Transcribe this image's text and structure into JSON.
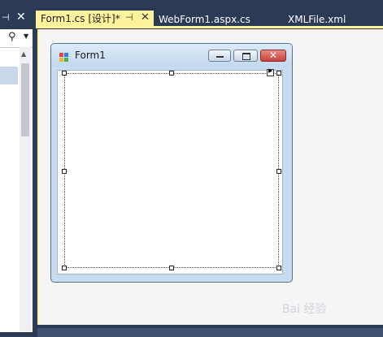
{
  "tabs": [
    {
      "label": "Form1.cs [设计]*",
      "active": true
    },
    {
      "label": "WebForm1.aspx.cs",
      "active": false
    },
    {
      "label": "XMLFile.xml",
      "active": false
    }
  ],
  "icons": {
    "pin": "pin-icon",
    "close": "close-icon",
    "search": "search-icon",
    "dropdown": "chevron-down-icon",
    "scroll_up": "chevron-up-icon",
    "form": "form-icon",
    "minimize": "minimize-icon",
    "maximize": "maximize-icon",
    "smart_tag": "smart-tag-icon"
  },
  "form": {
    "title": "Form1"
  },
  "watermark": "Bai 经验",
  "colors": {
    "active_tab": "#fff29d",
    "ide_background": "#2b3a55",
    "close_button": "#c8423b"
  }
}
